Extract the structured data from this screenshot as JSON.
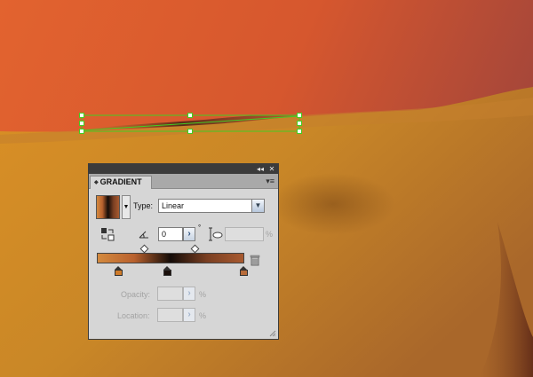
{
  "panel": {
    "title": "GRADIENT",
    "tab_arrows": "◆",
    "collapse_glyph": "◂◂",
    "close_glyph": "✕",
    "menu_glyph": "▾≡"
  },
  "gradient": {
    "swatch_dropdown_glyph": "▼",
    "type_label": "Type:",
    "type_value": "Linear",
    "type_dropdown_glyph": "▼",
    "angle_value": "0",
    "degree_symbol": "°",
    "aspect_value": "",
    "percent_symbol": "%",
    "stepper_glyph": "›",
    "opacity_label": "Opacity:",
    "opacity_value": "",
    "location_label": "Location:",
    "location_value": "",
    "stops": [
      {
        "color": "#cf7b2a",
        "position": 0.15,
        "selected": false
      },
      {
        "color": "#1a0f0a",
        "position": 0.48,
        "selected": false
      },
      {
        "color": "#b86c3a",
        "position": 1.0,
        "selected": false
      }
    ],
    "midpoints": [
      0.32,
      0.66
    ],
    "bar_colors": [
      "#d48a3e",
      "#b9612e",
      "#140c08",
      "#7a3f22",
      "#a85a30"
    ]
  },
  "colors": {
    "selection": "#44cc22",
    "sky_top": "#e0652f",
    "sky_right": "#a84a34",
    "sand": "#c98627"
  }
}
